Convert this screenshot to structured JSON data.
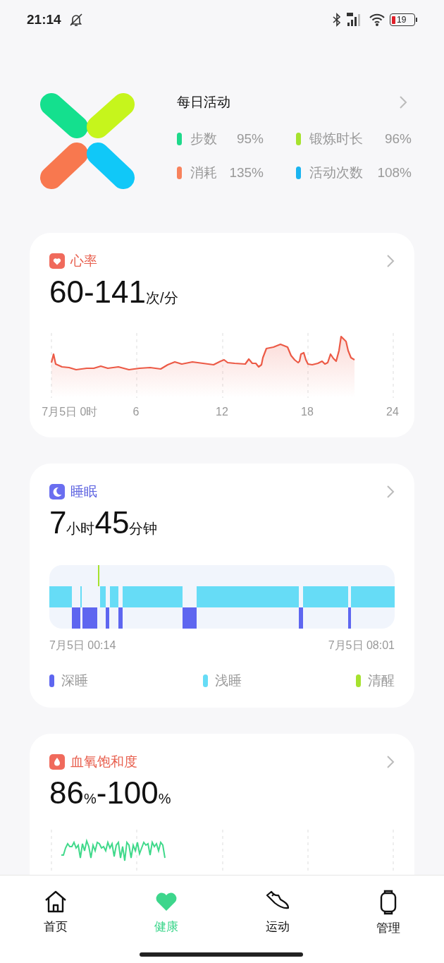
{
  "status_bar": {
    "time": "21:14",
    "battery": "19"
  },
  "daily_activity": {
    "title": "每日活动",
    "stats": [
      {
        "label": "步数",
        "value": "95%",
        "color": "#1ed98b"
      },
      {
        "label": "锻炼时长",
        "value": "96%",
        "color": "#a6e22e"
      },
      {
        "label": "消耗",
        "value": "135%",
        "color": "#f8825c"
      },
      {
        "label": "活动次数",
        "value": "108%",
        "color": "#1ab4f0"
      }
    ]
  },
  "heart_rate": {
    "title": "心率",
    "value": "60-141",
    "unit": "次/分",
    "x_labels": [
      "7月5日 0时",
      "6",
      "12",
      "18",
      "24"
    ]
  },
  "sleep": {
    "title": "睡眠",
    "value_parts": [
      {
        "kind": "number",
        "text": "7"
      },
      {
        "kind": "unit",
        "text": "小时"
      },
      {
        "kind": "number",
        "text": "45"
      },
      {
        "kind": "unit",
        "text": "分钟"
      }
    ],
    "start": "7月5日 00:14",
    "end": "7月5日 08:01",
    "legend": [
      {
        "label": "深睡",
        "color": "#5e66f0"
      },
      {
        "label": "浅睡",
        "color": "#66dcf6"
      },
      {
        "label": "清醒",
        "color": "#a6e22e"
      }
    ]
  },
  "blood_oxygen": {
    "title": "血氧饱和度",
    "value_parts": [
      {
        "kind": "number",
        "text": "86"
      },
      {
        "kind": "unit",
        "text": "%"
      },
      {
        "kind": "number",
        "text": "-100"
      },
      {
        "kind": "unit",
        "text": "%"
      }
    ]
  },
  "tabs": [
    {
      "label": "首页",
      "selected": false
    },
    {
      "label": "健康",
      "selected": true
    },
    {
      "label": "运动",
      "selected": false
    },
    {
      "label": "管理",
      "selected": false
    }
  ]
}
